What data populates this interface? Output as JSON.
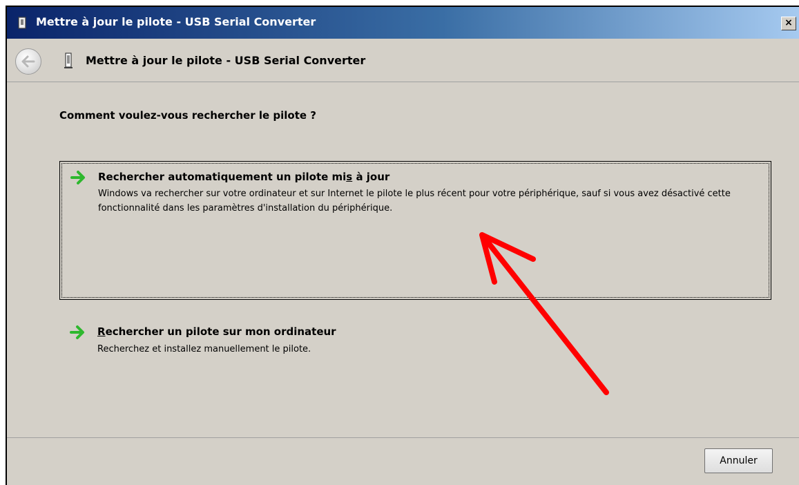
{
  "titlebar": {
    "title": "Mettre à jour le pilote - USB Serial Converter",
    "icon": "usb-device-icon",
    "close_label": "×"
  },
  "navbar": {
    "back_icon": "back-arrow-icon",
    "device_icon": "usb-device-icon",
    "title": "Mettre à jour le pilote - USB Serial Converter"
  },
  "content": {
    "question": "Comment voulez-vous rechercher le pilote ?",
    "options": [
      {
        "title_before": "Rechercher automatiquement un pilote mi",
        "title_accel": "s",
        "title_after": " à jour",
        "description": "Windows va rechercher sur votre ordinateur et sur Internet le pilote le plus récent pour votre périphérique, sauf si vous avez désactivé cette fonctionnalité dans les paramètres d'installation du périphérique.",
        "icon": "green-arrow-icon",
        "selected": true
      },
      {
        "title_accel": "R",
        "title_after": "echercher un pilote sur mon ordinateur",
        "description": "Recherchez et installez manuellement le pilote.",
        "icon": "green-arrow-icon",
        "selected": false
      }
    ]
  },
  "footer": {
    "cancel_label": "Annuler"
  },
  "colors": {
    "titlebar_start": "#0a246a",
    "titlebar_end": "#a6caf0",
    "window_bg": "#d4d0c8",
    "arrow_green": "#2eb82e",
    "annotation_red": "#ff0000"
  }
}
